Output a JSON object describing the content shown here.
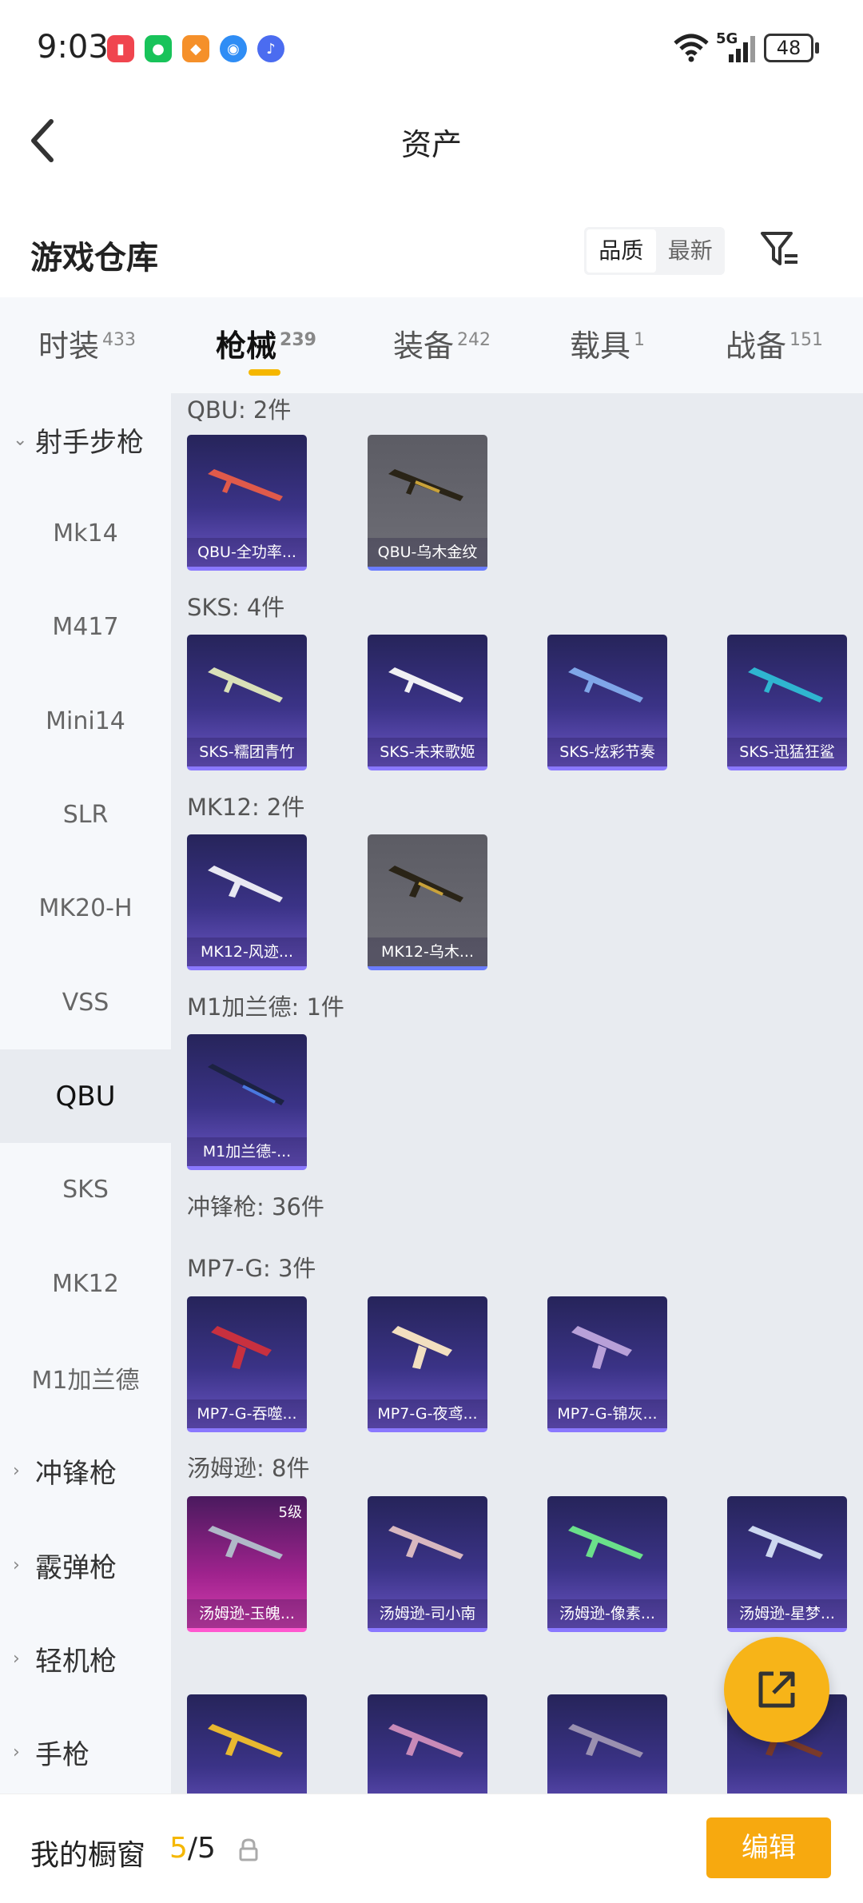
{
  "status": {
    "time": "9:03",
    "battery": "48",
    "network": "5G"
  },
  "header": {
    "title": "资产"
  },
  "warehouse": {
    "title": "游戏仓库",
    "sort_quality": "品质",
    "sort_latest": "最新"
  },
  "tabs": [
    {
      "label": "时装",
      "count": "433"
    },
    {
      "label": "枪械",
      "count": "239"
    },
    {
      "label": "装备",
      "count": "242"
    },
    {
      "label": "载具",
      "count": "1"
    },
    {
      "label": "战备",
      "count": "151"
    }
  ],
  "sidebar": {
    "items": [
      "射手步枪",
      "Mk14",
      "M417",
      "Mini14",
      "SLR",
      "MK20-H",
      "VSS",
      "QBU",
      "SKS",
      "MK12",
      "M1加兰德",
      "冲锋枪",
      "霰弹枪",
      "轻机枪",
      "手枪"
    ]
  },
  "content": {
    "groups": [
      {
        "label": "QBU: 2件",
        "items": [
          "QBU-全功率...",
          "QBU-乌木金纹"
        ]
      },
      {
        "label": "SKS: 4件",
        "items": [
          "SKS-糯团青竹",
          "SKS-未来歌姬",
          "SKS-炫彩节奏",
          "SKS-迅猛狂鲨"
        ]
      },
      {
        "label": "MK12: 2件",
        "items": [
          "MK12-风迹...",
          "MK12-乌木..."
        ]
      },
      {
        "label": "M1加兰德: 1件",
        "items": [
          "M1加兰德-..."
        ]
      },
      {
        "label": "冲锋枪: 36件"
      },
      {
        "label": "MP7-G: 3件",
        "items": [
          "MP7-G-吞噬...",
          "MP7-G-夜鸢...",
          "MP7-G-锦灰..."
        ]
      },
      {
        "label": "汤姆逊: 8件",
        "items": [
          "汤姆逊-玉魄...",
          "汤姆逊-司小南",
          "汤姆逊-像素...",
          "汤姆逊-星梦..."
        ],
        "level_badge": "5级"
      }
    ]
  },
  "bottom": {
    "window_label": "我的橱窗",
    "count_current": "5",
    "count_total": "/5",
    "edit_label": "编辑"
  },
  "colors": {
    "accent": "#f5b700",
    "edit_button": "#f7a90f"
  }
}
